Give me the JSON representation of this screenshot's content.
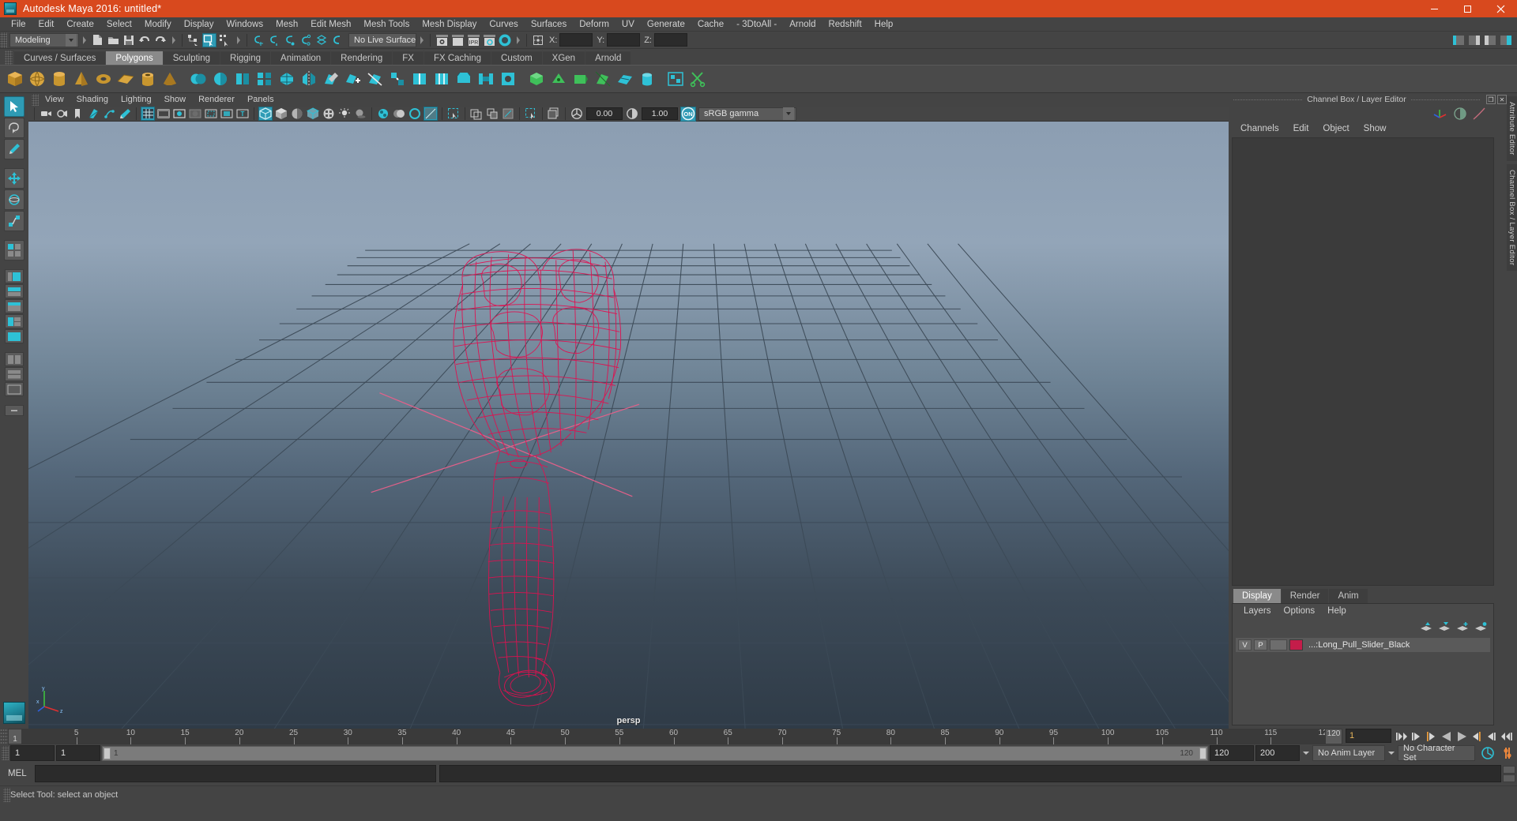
{
  "window": {
    "title": "Autodesk Maya 2016: untitled*",
    "titlebar_color": "#d8491e",
    "minimize": "–",
    "maximize": "❐",
    "close": "✕"
  },
  "menubar": {
    "items": [
      "File",
      "Edit",
      "Create",
      "Select",
      "Modify",
      "Display",
      "Windows",
      "Mesh",
      "Edit Mesh",
      "Mesh Tools",
      "Mesh Display",
      "Curves",
      "Surfaces",
      "Deform",
      "UV",
      "Generate",
      "Cache",
      "- 3DtoAll -",
      "Arnold",
      "Redshift",
      "Help"
    ]
  },
  "statusline": {
    "menuset": "Modeling",
    "live_surface": "No Live Surface",
    "coord_labels": {
      "x": "X:",
      "y": "Y:",
      "z": "Z:"
    },
    "coord_values": {
      "x": "",
      "y": "",
      "z": ""
    },
    "icons": [
      "new-scene-icon",
      "open-scene-icon",
      "save-scene-icon",
      "undo-icon",
      "redo-icon",
      "select-by-hierarchy-icon",
      "select-by-object-icon",
      "select-by-component-icon",
      "snap-to-grid-icon",
      "snap-to-curve-icon",
      "snap-to-point-icon",
      "snap-to-projected-center-icon",
      "snap-to-view-plane-icon",
      "snap-to-live-icon",
      "render-view-icon",
      "render-region-icon",
      "ipr-render-icon",
      "render-settings-icon",
      "hypershade-icon",
      "input-output-connections-icon"
    ]
  },
  "shelf": {
    "tabs": [
      "Curves / Surfaces",
      "Polygons",
      "Sculpting",
      "Rigging",
      "Animation",
      "Rendering",
      "FX",
      "FX Caching",
      "Custom",
      "XGen",
      "Arnold"
    ],
    "active_tab": "Polygons",
    "icons": [
      "poly-cube-icon",
      "poly-sphere-icon",
      "poly-cylinder-icon",
      "poly-cone-icon",
      "poly-torus-icon",
      "poly-plane-icon",
      "poly-pipe-icon",
      "poly-prism-icon",
      "poly-pyramid-icon",
      "poly-helix-icon",
      "poly-soccer-ball-icon",
      "boolean-union-icon",
      "combine-icon",
      "separate-icon",
      "extract-icon",
      "smooth-icon",
      "mirror-icon",
      "create-polygon-tool-icon",
      "append-polygon-icon",
      "multi-cut-icon",
      "target-weld-icon",
      "insert-edge-loop-icon",
      "offset-edge-loop-icon",
      "bevel-icon",
      "bridge-icon",
      "fill-hole-icon",
      "extrude-icon",
      "poke-icon",
      "wedge-icon",
      "uv-editor-icon",
      "uv-planar-icon",
      "uv-cylindrical-icon",
      "uv-spherical-icon",
      "uv-automatic-icon",
      "uv-camera-icon",
      "uv-layout-icon"
    ]
  },
  "toolbox": {
    "tools": [
      "select-tool",
      "lasso-select-tool",
      "paint-select-tool",
      "move-tool",
      "rotate-tool",
      "scale-tool",
      "last-tool-used",
      "four-view-layout",
      "persp-outliner-layout",
      "persp-graph-layout",
      "persp-hypershade-layout",
      "persp-relationship-layout",
      "persp-single-layout",
      "two-panes-side-layout",
      "two-panes-stacked-layout",
      "single-pane-layout"
    ],
    "selected_tool": "select-tool"
  },
  "viewport": {
    "menus": [
      "View",
      "Shading",
      "Lighting",
      "Show",
      "Renderer",
      "Panels"
    ],
    "camera_label": "persp",
    "exposure_value": "0.00",
    "gamma_value": "1.00",
    "color_management": "sRGB gamma",
    "color_management_state": "ON",
    "toolbar_icons": [
      "select-camera-icon",
      "lock-camera-icon",
      "camera-attributes-icon",
      "bookmark-icon",
      "image-plane-icon",
      "twopoint-icon",
      "grease-pencil-icon",
      "grid-toggle-icon",
      "film-gate-icon",
      "resolution-gate-icon",
      "gate-mask-icon",
      "field-chart-icon",
      "safe-action-icon",
      "safe-title-icon",
      "wireframe-icon",
      "smooth-shade-all-icon",
      "flat-shade-icon",
      "shaded-wireframe-icon",
      "textured-icon",
      "use-all-lights-icon",
      "shadows-icon",
      "screen-space-ao-icon",
      "motion-blur-icon",
      "multisample-icon",
      "depth-peel-icon",
      "isolate-select-icon",
      "xray-icon",
      "xray-joints-icon"
    ],
    "gizmo_axes": [
      "y",
      "z",
      "x"
    ],
    "grid": {
      "lines": 20,
      "color": "#3d4a56"
    },
    "model": {
      "name": "Long_Pull_Slider_Black",
      "wireframe_color": "#e01050",
      "pivot_cross_color": "#e05070"
    }
  },
  "right_panel": {
    "title": "Channel Box / Layer Editor",
    "undock_button": "❐",
    "close_button": "✕",
    "channelbox_menus": [
      "Channels",
      "Edit",
      "Object",
      "Show"
    ],
    "quick_icons": [
      "transform-gizmo-icon",
      "shading-sphere-icon",
      "curve-icon"
    ],
    "layer_tabs": [
      "Display",
      "Render",
      "Anim"
    ],
    "layer_tabs_active": "Display",
    "layer_menus": [
      "Layers",
      "Options",
      "Help"
    ],
    "layer_tool_icons": [
      "move-layer-up-icon",
      "move-layer-down-icon",
      "new-layer-icon",
      "new-layer-from-selected-icon"
    ],
    "layers": [
      {
        "visibility": "V",
        "playback": "P",
        "display_type": "",
        "color": "#c41d4a",
        "name": "...:Long_Pull_Slider_Black"
      }
    ],
    "vertical_tabs": [
      "Attribute Editor",
      "Channel Box / Layer Editor"
    ]
  },
  "timeline": {
    "start_label": "1",
    "end_label": "120",
    "current_frame": "1",
    "tick_labels": [
      "5",
      "10",
      "15",
      "20",
      "25",
      "30",
      "35",
      "40",
      "45",
      "50",
      "55",
      "60",
      "65",
      "70",
      "75",
      "80",
      "85",
      "90",
      "95",
      "100",
      "105",
      "110",
      "115",
      "120"
    ],
    "tick_values": [
      5,
      10,
      15,
      20,
      25,
      30,
      35,
      40,
      45,
      50,
      55,
      60,
      65,
      70,
      75,
      80,
      85,
      90,
      95,
      100,
      105,
      110,
      115,
      120
    ],
    "max_frame": 120,
    "playback_buttons": [
      "go-to-start-icon",
      "step-back-keyframe-icon",
      "step-back-frame-icon",
      "play-backwards-icon",
      "play-forwards-icon",
      "step-forward-frame-icon",
      "step-forward-keyframe-icon",
      "go-to-end-icon"
    ]
  },
  "range_slider": {
    "anim_start": "1",
    "range_start": "1",
    "bar_start_label": "1",
    "bar_end_label": "120",
    "range_end": "120",
    "anim_end": "200",
    "anim_layer": "No Anim Layer",
    "character_set": "No Character Set",
    "icons": [
      "auto-keyframe-icon",
      "animation-preferences-icon"
    ]
  },
  "command_line": {
    "language_label": "MEL",
    "input_value": "",
    "output_value": "",
    "script_editor_icon": "script-editor-icon"
  },
  "help_line": {
    "text": "Select Tool: select an object"
  }
}
